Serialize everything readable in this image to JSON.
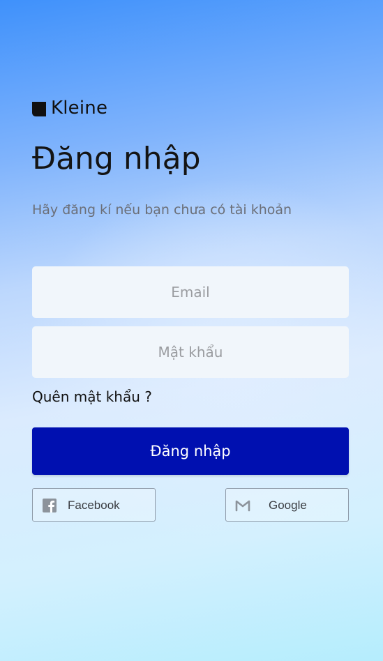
{
  "brand": {
    "name": "Kleine"
  },
  "login": {
    "title": "Đăng nhập",
    "subtitle": "Hãy đăng kí nếu bạn chưa có tài khoản",
    "email_placeholder": "Email",
    "password_placeholder": "Mật khẩu",
    "forgot_label": "Quên mật khẩu ?",
    "submit_label": "Đăng nhập"
  },
  "social": {
    "facebook_label": "Facebook",
    "google_label": "Google",
    "facebook_icon": "facebook-icon",
    "google_icon": "gmail-icon"
  },
  "colors": {
    "primary_button": "#0010b0",
    "input_background": "#f1f6fb",
    "social_icon": "#8c939b"
  }
}
